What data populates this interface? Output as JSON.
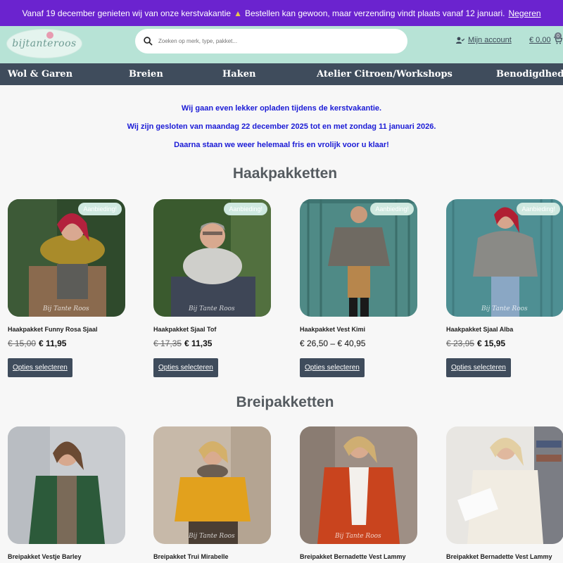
{
  "promo": {
    "text_before": "Vanaf 19 december genieten wij van onze kerstvakantie",
    "text_after": "Bestellen kan gewoon, maar verzending vindt plaats vanaf 12 januari.",
    "icon": "christmas-tree-icon",
    "dismiss_label": "Negeren",
    "background": "#6b23cf"
  },
  "header": {
    "logo_text": "bijtanteroos",
    "search_placeholder": "Zoeken op merk, type, pakket...",
    "account_label": "Mijn account",
    "cart_total": "€ 0,00",
    "cart_count": "0",
    "background": "#b7e3d6"
  },
  "nav": {
    "background": "#3f4c5c",
    "items": [
      "Wol & Garen",
      "Breien",
      "Haken",
      "Atelier Citroen/Workshops",
      "Benodigdheden"
    ]
  },
  "notice": {
    "line1": "Wij gaan even lekker opladen tijdens de kerstvakantie.",
    "line2": "Wij zijn gesloten van maandag 22 december 2025 tot en met zondag 11 januari 2026.",
    "line3": "Daarna staan we weer helemaal fris en vrolijk voor u klaar!",
    "color": "#1b1bd6"
  },
  "sections": [
    {
      "title": "Haakpakketten",
      "products": [
        {
          "title": "Haakpakket Funny Rosa Sjaal",
          "price_old": "€ 15,00",
          "price_new": "€ 11,95",
          "badge": "Aanbieding!",
          "button": "Opties selecteren",
          "watermark": "Bij Tante Roos"
        },
        {
          "title": "Haakpakket Sjaal Tof",
          "price_old": "€ 17,35",
          "price_new": "€ 11,35",
          "badge": "Aanbieding!",
          "button": "Opties selecteren",
          "watermark": "Bij Tante Roos"
        },
        {
          "title": "Haakpakket Vest Kimi",
          "price_range": "€ 26,50 – € 40,95",
          "badge": "Aanbieding!",
          "button": "Opties selecteren"
        },
        {
          "title": "Haakpakket Sjaal Alba",
          "price_old": "€ 23,95",
          "price_new": "€ 15,95",
          "badge": "Aanbieding!",
          "button": "Opties selecteren",
          "watermark": "Bij Tante Roos"
        }
      ]
    },
    {
      "title": "Breipakketten",
      "products": [
        {
          "title": "Breipakket Vestje Barley"
        },
        {
          "title": "Breipakket Trui Mirabelle",
          "watermark": "Bij Tante Roos"
        },
        {
          "title": "Breipakket Bernadette Vest Lammy",
          "watermark": "Bij Tante Roos"
        },
        {
          "title": "Breipakket Bernadette Vest Lammy"
        }
      ]
    }
  ]
}
